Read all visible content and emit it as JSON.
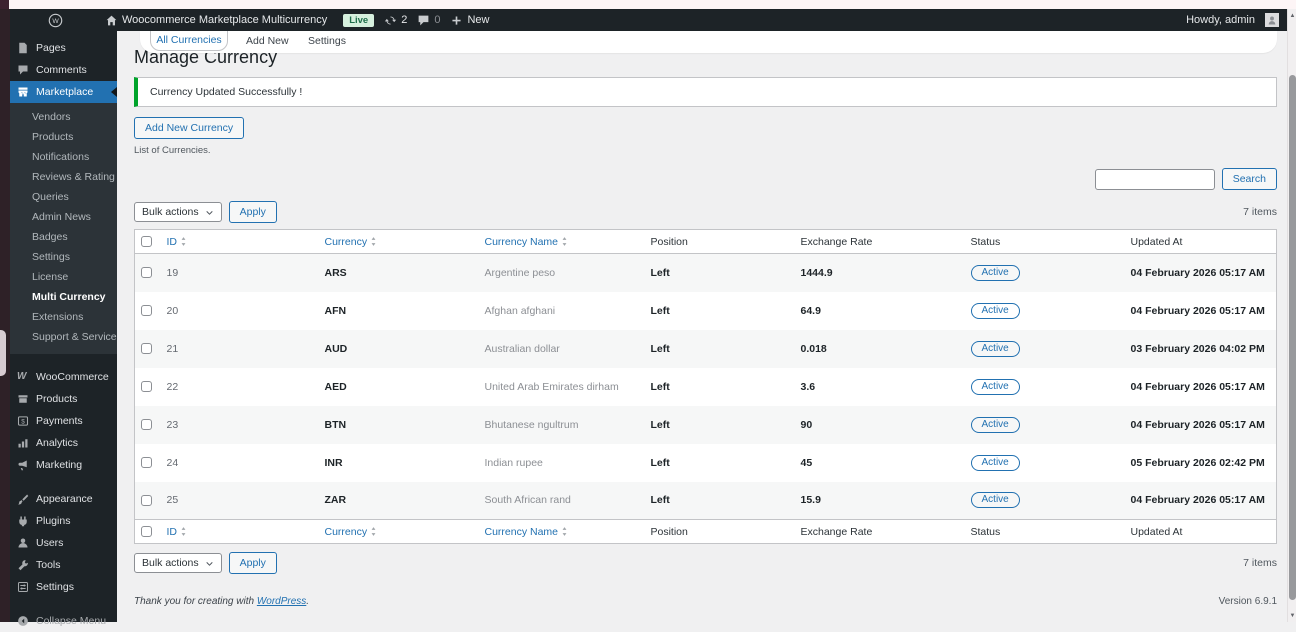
{
  "admin_bar": {
    "site_name": "Woocommerce Marketplace Multicurrency",
    "live_badge": "Live",
    "updates_count": "2",
    "comments_count": "0",
    "new_label": "New",
    "howdy": "Howdy, admin"
  },
  "sidebar": {
    "items": [
      {
        "label": "Pages",
        "icon": "pages-icon"
      },
      {
        "label": "Comments",
        "icon": "comments-icon"
      },
      {
        "label": "Marketplace",
        "icon": "store-icon",
        "active": true,
        "submenu": [
          "Vendors",
          "Products",
          "Notifications",
          "Reviews & Rating",
          "Queries",
          "Admin News",
          "Badges",
          "Settings",
          "License",
          "Multi Currency",
          "Extensions",
          "Support & Services"
        ],
        "current_submenu": "Multi Currency"
      },
      {
        "label": "WooCommerce",
        "icon": "woocommerce-icon",
        "gap": true
      },
      {
        "label": "Products",
        "icon": "products-icon"
      },
      {
        "label": "Payments",
        "icon": "payments-icon"
      },
      {
        "label": "Analytics",
        "icon": "analytics-icon"
      },
      {
        "label": "Marketing",
        "icon": "marketing-icon"
      },
      {
        "label": "Appearance",
        "icon": "appearance-icon",
        "gap": true
      },
      {
        "label": "Plugins",
        "icon": "plugins-icon"
      },
      {
        "label": "Users",
        "icon": "users-icon"
      },
      {
        "label": "Tools",
        "icon": "tools-icon"
      },
      {
        "label": "Settings",
        "icon": "settings-icon"
      },
      {
        "label": "Collapse Menu",
        "icon": "collapse-icon",
        "gap": true,
        "muted": true
      }
    ]
  },
  "tabs": [
    "All Currencies",
    "Add New",
    "Settings"
  ],
  "page": {
    "title": "Manage Currency",
    "notice": "Currency Updated Successfully !",
    "add_button": "Add New Currency",
    "subtitle": "List of Currencies.",
    "search_button": "Search",
    "search_value": "",
    "bulk_actions": "Bulk actions",
    "apply": "Apply",
    "items_count": "7 items"
  },
  "table": {
    "columns": [
      {
        "label": "ID",
        "sortable": true
      },
      {
        "label": "Currency",
        "sortable": true
      },
      {
        "label": "Currency Name",
        "sortable": true
      },
      {
        "label": "Position",
        "sortable": false
      },
      {
        "label": "Exchange Rate",
        "sortable": false
      },
      {
        "label": "Status",
        "sortable": false
      },
      {
        "label": "Updated At",
        "sortable": false
      }
    ],
    "rows": [
      {
        "id": "19",
        "currency": "ARS",
        "name": "Argentine peso",
        "position": "Left",
        "rate": "1444.9",
        "status": "Active",
        "updated": "04 February 2026 05:17 AM"
      },
      {
        "id": "20",
        "currency": "AFN",
        "name": "Afghan afghani",
        "position": "Left",
        "rate": "64.9",
        "status": "Active",
        "updated": "04 February 2026 05:17 AM"
      },
      {
        "id": "21",
        "currency": "AUD",
        "name": "Australian dollar",
        "position": "Left",
        "rate": "0.018",
        "status": "Active",
        "updated": "03 February 2026 04:02 PM"
      },
      {
        "id": "22",
        "currency": "AED",
        "name": "United Arab Emirates dirham",
        "position": "Left",
        "rate": "3.6",
        "status": "Active",
        "updated": "04 February 2026 05:17 AM"
      },
      {
        "id": "23",
        "currency": "BTN",
        "name": "Bhutanese ngultrum",
        "position": "Left",
        "rate": "90",
        "status": "Active",
        "updated": "04 February 2026 05:17 AM"
      },
      {
        "id": "24",
        "currency": "INR",
        "name": "Indian rupee",
        "position": "Left",
        "rate": "45",
        "status": "Active",
        "updated": "05 February 2026 02:42 PM"
      },
      {
        "id": "25",
        "currency": "ZAR",
        "name": "South African rand",
        "position": "Left",
        "rate": "15.9",
        "status": "Active",
        "updated": "04 February 2026 05:17 AM"
      }
    ]
  },
  "footer": {
    "thanks_prefix": "Thank you for creating with ",
    "wordpress_link": "WordPress",
    "thanks_suffix": ".",
    "version": "Version 6.9.1"
  },
  "colors": {
    "accent": "#2271b1",
    "success_notice": "#00a32a",
    "admin_dark": "#1d2327",
    "submenu_dark": "#2c3338",
    "live_badge_bg": "#d6f0de",
    "live_badge_text": "#1f6e4b"
  }
}
